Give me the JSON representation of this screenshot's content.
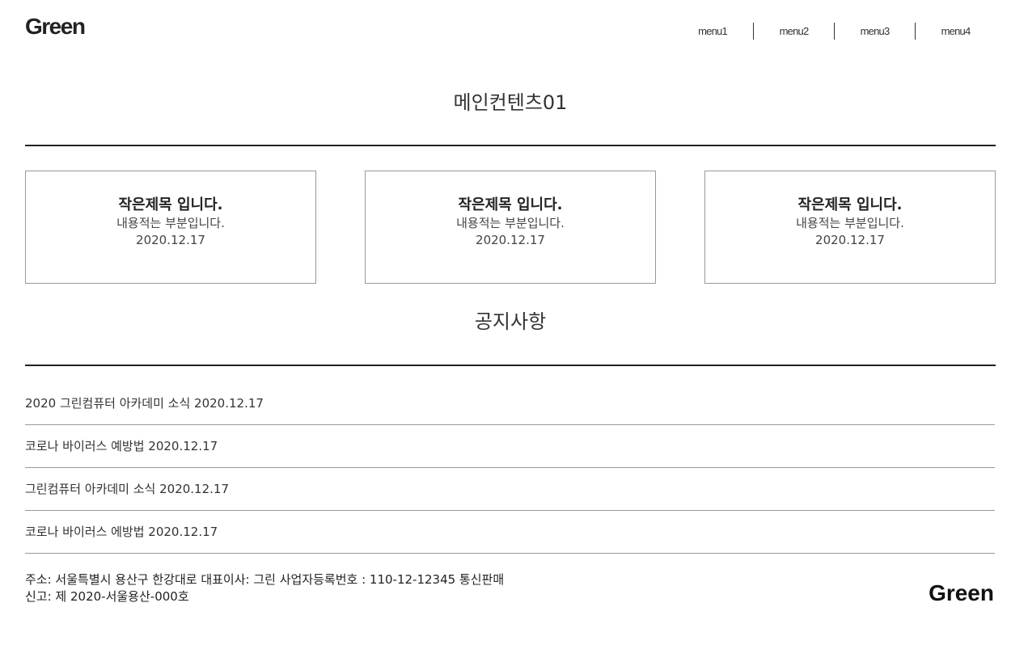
{
  "header": {
    "logo": "Green",
    "nav": [
      "menu1",
      "menu2",
      "menu3",
      "menu4"
    ]
  },
  "main": {
    "title": "메인컨텐츠01",
    "cards": [
      {
        "title": "작은제목 입니다.",
        "desc": "내용적는 부분입니다.",
        "date": "2020.12.17"
      },
      {
        "title": "작은제목 입니다.",
        "desc": "내용적는 부분입니다.",
        "date": "2020.12.17"
      },
      {
        "title": "작은제목 입니다.",
        "desc": "내용적는 부분입니다.",
        "date": "2020.12.17"
      }
    ]
  },
  "notice": {
    "title": "공지사항",
    "items": [
      "2020 그린컴퓨터 아카데미 소식 2020.12.17",
      "코로나 바이러스 예방법 2020.12.17",
      "그린컴퓨터 아카데미 소식 2020.12.17",
      "코로나 바이러스 에방법 2020.12.17"
    ]
  },
  "footer": {
    "address_line1": "주소: 서울특별시 용산구 한강대로 대표이사: 그린 사업자등록번호 : 110-12-12345 통신판매",
    "address_line2": "신고: 제 2020-서울용산-000호",
    "logo": "Green"
  }
}
